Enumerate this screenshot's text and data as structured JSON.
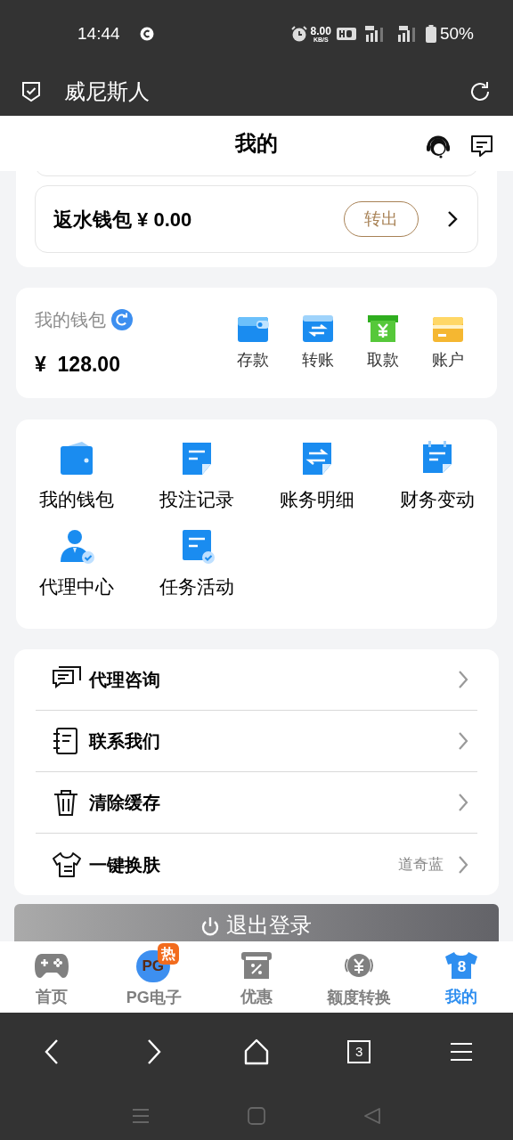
{
  "status_bar": {
    "time": "14:44",
    "speed": "8.00",
    "speed_unit": "KB/S",
    "battery": "50%"
  },
  "browser": {
    "title": "威尼斯人",
    "tab_count": "3"
  },
  "header": {
    "title": "我的"
  },
  "rebate_wallet": {
    "label": "返水钱包 ¥ 0.00",
    "button": "转出"
  },
  "wallet": {
    "title": "我的钱包",
    "balance": "¥  128.00",
    "actions": [
      {
        "kind": "deposit",
        "label": "存款"
      },
      {
        "kind": "transfer",
        "label": "转账"
      },
      {
        "kind": "withdraw",
        "label": "取款"
      },
      {
        "kind": "account",
        "label": "账户"
      }
    ]
  },
  "shortcuts": [
    {
      "kind": "wallet",
      "label": "我的钱包"
    },
    {
      "kind": "note",
      "label": "投注记录"
    },
    {
      "kind": "swap",
      "label": "账务明细"
    },
    {
      "kind": "calendar",
      "label": "财务变动"
    },
    {
      "kind": "agent",
      "label": "代理中心"
    },
    {
      "kind": "task",
      "label": "任务活动"
    }
  ],
  "menu": [
    {
      "kind": "chat",
      "label": "代理咨询"
    },
    {
      "kind": "contact",
      "label": "联系我们"
    },
    {
      "kind": "trash",
      "label": "清除缓存"
    },
    {
      "kind": "shirt",
      "label": "一键换肤",
      "value": "道奇蓝"
    }
  ],
  "logout": {
    "label": "退出登录"
  },
  "tabs": [
    {
      "kind": "gamepad",
      "label": "首页",
      "selected": false
    },
    {
      "kind": "pg",
      "label": "PG电子",
      "selected": false,
      "logo": "PG",
      "badge": "热"
    },
    {
      "kind": "discount",
      "label": "优惠",
      "selected": false
    },
    {
      "kind": "exchange",
      "label": "额度转换",
      "selected": false
    },
    {
      "kind": "jersey",
      "label": "我的",
      "selected": true,
      "number": "8"
    }
  ]
}
